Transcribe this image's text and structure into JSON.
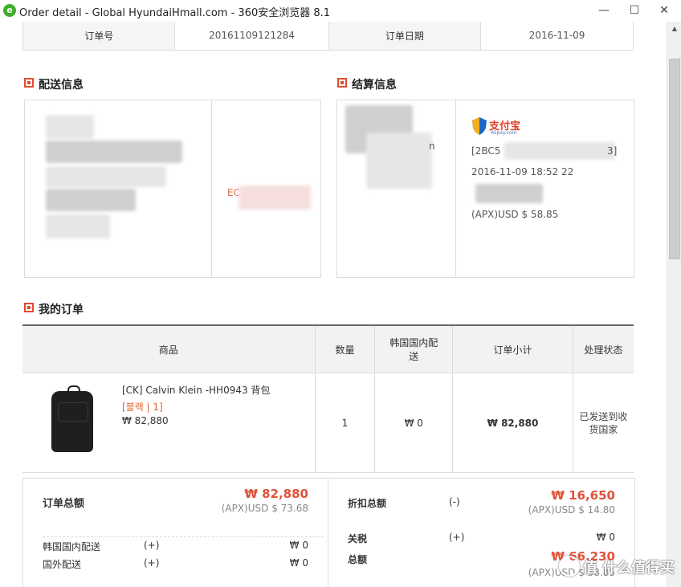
{
  "window": {
    "title": "Order detail - Global HyundaiHmall.com - 360安全浏览器 8.1",
    "icon": "360-browser-icon",
    "buttons": {
      "minimize": "—",
      "maximize": "☐",
      "close": "✕"
    }
  },
  "order_header": {
    "order_no_label": "订单号",
    "order_no": "20161109121284",
    "order_date_label": "订单日期",
    "order_date": "2016-11-09"
  },
  "delivery": {
    "title": "配送信息",
    "partial_text": "EC"
  },
  "payment": {
    "title": "结算信息",
    "left_partial": "n",
    "alipay_label": "支付宝",
    "alipay_sub": "Alipay.com",
    "trade_no_prefix": "[2BC5",
    "trade_no_suffix": "3]",
    "datetime": "2016-11-09 18:52 22",
    "amount": "(APX)USD $ 58.85"
  },
  "my_order": {
    "title": "我的订单",
    "columns": [
      "商品",
      "数量",
      "韩国国内配送",
      "订单小计",
      "处理状态"
    ],
    "items": [
      {
        "name": "[CK] Calvin Klein -HH0943 背包",
        "option": "[블랙 | 1]",
        "price": "₩ 82,880",
        "qty": "1",
        "domestic_shipping": "₩ 0",
        "subtotal": "₩ 82,880",
        "status": "已发送到收货国家"
      }
    ]
  },
  "summary": {
    "order_total_label": "订单总额",
    "order_total_krw": "₩ 82,880",
    "order_total_usd": "(APX)USD $ 73.68",
    "domestic_label": "韩国国内配送",
    "domestic_sign": "(+)",
    "domestic_value": "₩ 0",
    "overseas_label": "国外配送",
    "overseas_sign": "(+)",
    "overseas_value": "₩ 0",
    "discount_label": "折扣总额",
    "discount_sign": "(-)",
    "discount_krw": "₩ 16,650",
    "discount_usd": "(APX)USD $ 14.80",
    "tax_label": "关税",
    "tax_sign": "(+)",
    "tax_value": "₩ 0",
    "total_label": "总额",
    "total_krw": "₩ 66,230",
    "total_usd": "(APX)USD $ 58.85"
  },
  "watermark": "值 什么值得买",
  "colors": {
    "accent": "#e0533a",
    "border": "#dcdcdc",
    "header_bg": "#f2f2f2"
  }
}
